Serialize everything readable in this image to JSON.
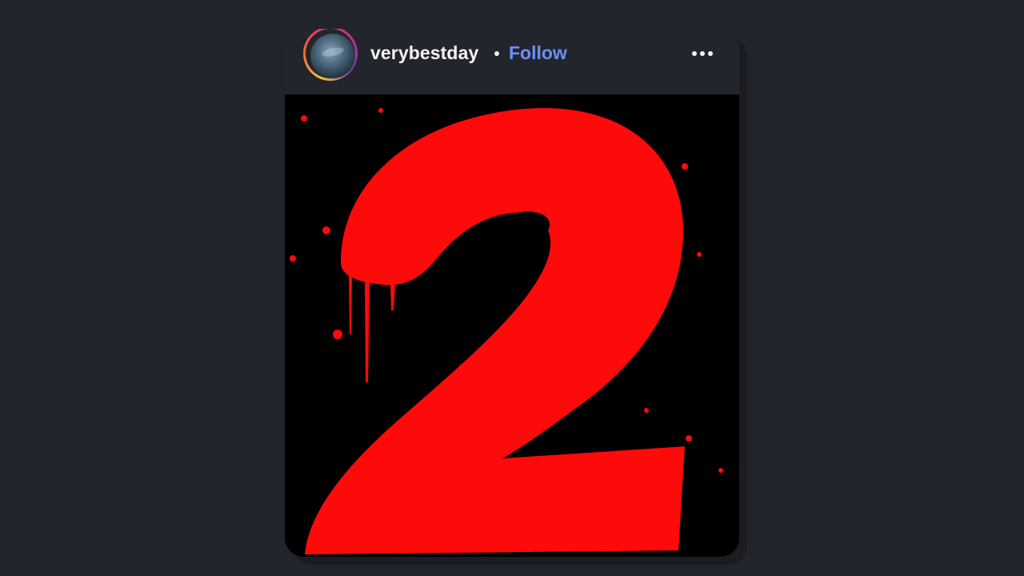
{
  "post": {
    "username": "verybestday",
    "separator": "•",
    "follow_label": "Follow",
    "more_icon": "more-horizontal-icon",
    "avatar_icon": "avatar-photo",
    "image": {
      "depicted_numeral": "2",
      "numeral_color": "#ff0a0a",
      "background_color": "#000000"
    }
  },
  "colors": {
    "page_background": "#22242c",
    "card_background": "#23252d",
    "follow_accent": "#6c8ff5",
    "text_primary": "#f5f5f5"
  }
}
